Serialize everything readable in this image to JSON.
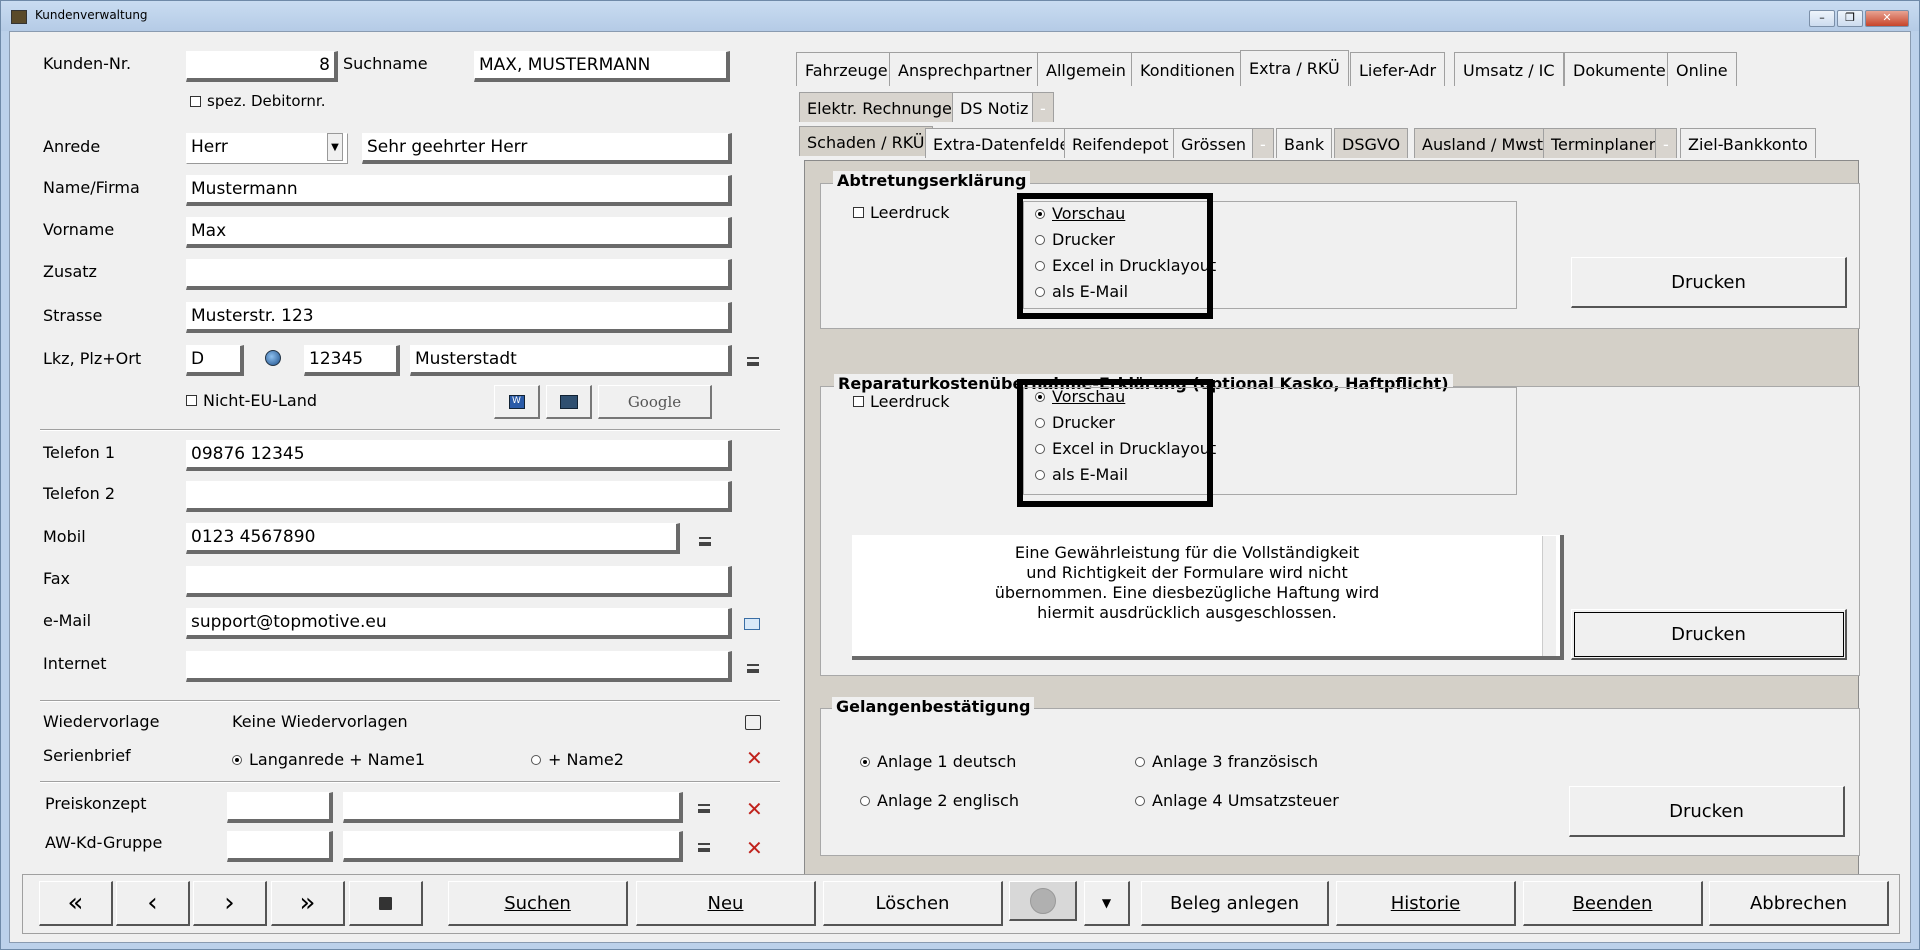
{
  "window": {
    "title": "Kundenverwaltung",
    "min": "–",
    "max": "❐",
    "close": "✕"
  },
  "left": {
    "kunden_nr_label": "Kunden-Nr.",
    "kunden_nr": "8",
    "suchname_label": "Suchname",
    "suchname": "MAX, MUSTERMANN",
    "spez_debitor": "spez. Debitornr.",
    "anrede_label": "Anrede",
    "anrede": "Herr",
    "briefanrede": "Sehr geehrter Herr",
    "name_label": "Name/Firma",
    "name": "Mustermann",
    "vorname_label": "Vorname",
    "vorname": "Max",
    "zusatz_label": "Zusatz",
    "zusatz": "",
    "strasse_label": "Strasse",
    "strasse": "Musterstr. 123",
    "lkz_label": "Lkz, Plz+Ort",
    "lkz": "D",
    "plz": "12345",
    "ort": "Musterstadt",
    "nicht_eu": "Nicht-EU-Land",
    "google_label": "Google",
    "telefon1_label": "Telefon 1",
    "telefon1": "09876 12345",
    "telefon2_label": "Telefon 2",
    "telefon2": "",
    "mobil_label": "Mobil",
    "mobil": "0123 4567890",
    "fax_label": "Fax",
    "fax": "",
    "email_label": "e-Mail",
    "email": "support@topmotive.eu",
    "internet_label": "Internet",
    "internet": "",
    "wiedervorlage_label": "Wiedervorlage",
    "wiedervorlage": "Keine Wiedervorlagen",
    "serienbrief_label": "Serienbrief",
    "serienbrief_opt1": "Langanrede + Name1",
    "serienbrief_opt2": "+ Name2",
    "preiskonzept_label": "Preiskonzept",
    "awkd_label": "AW-Kd-Gruppe"
  },
  "tabs_row1": [
    "Fahrzeuge",
    "Ansprechpartner",
    "Allgemein",
    "Konditionen",
    "Extra / RKÜ",
    "Liefer-Adr",
    "Umsatz / IC",
    "Dokumente",
    "Online"
  ],
  "tabs_row2": [
    "Elektr. Rechnungen",
    "DS Notiz",
    "-"
  ],
  "tabs_row3": [
    "Schaden / RKÜ",
    "Extra-Datenfelder",
    "Reifendepot",
    "Grössen",
    "-",
    "Bank",
    "DSGVO",
    "Ausland / Mwst",
    "Terminplaner",
    "-",
    "Ziel-Bankkonto"
  ],
  "abtretung": {
    "title": "Abtretungserklärung",
    "leerdruck": "Leerdruck",
    "options": [
      "Vorschau",
      "Drucker",
      "Excel in Drucklayout",
      "als E-Mail"
    ],
    "button": "Drucken"
  },
  "reparatur": {
    "title": "Reparaturkostenübernahme-Erklärung (optional Kasko, Haftpflicht)",
    "leerdruck": "Leerdruck",
    "options": [
      "Vorschau",
      "Drucker",
      "Excel in Drucklayout",
      "als E-Mail"
    ],
    "note_lines": [
      "Eine Gewährleistung für die Vollständigkeit",
      "und Richtigkeit der Formulare wird nicht",
      "übernommen. Eine diesbezügliche Haftung wird",
      "hiermit ausdrücklich ausgeschlossen."
    ],
    "button": "Drucken"
  },
  "gelangen": {
    "title": "Gelangenbestätigung",
    "opt1": "Anlage 1 deutsch",
    "opt2": "Anlage 2 englisch",
    "opt3": "Anlage 3 französisch",
    "opt4": "Anlage 4 Umsatzsteuer",
    "button": "Drucken"
  },
  "bottom": {
    "first": "«",
    "prev": "‹",
    "next": "›",
    "last": "»",
    "suchen": "Suchen",
    "neu": "Neu",
    "loeschen": "Löschen",
    "beleg": "Beleg anlegen",
    "historie": "Historie",
    "beenden": "Beenden",
    "abbrechen": "Abbrechen"
  }
}
